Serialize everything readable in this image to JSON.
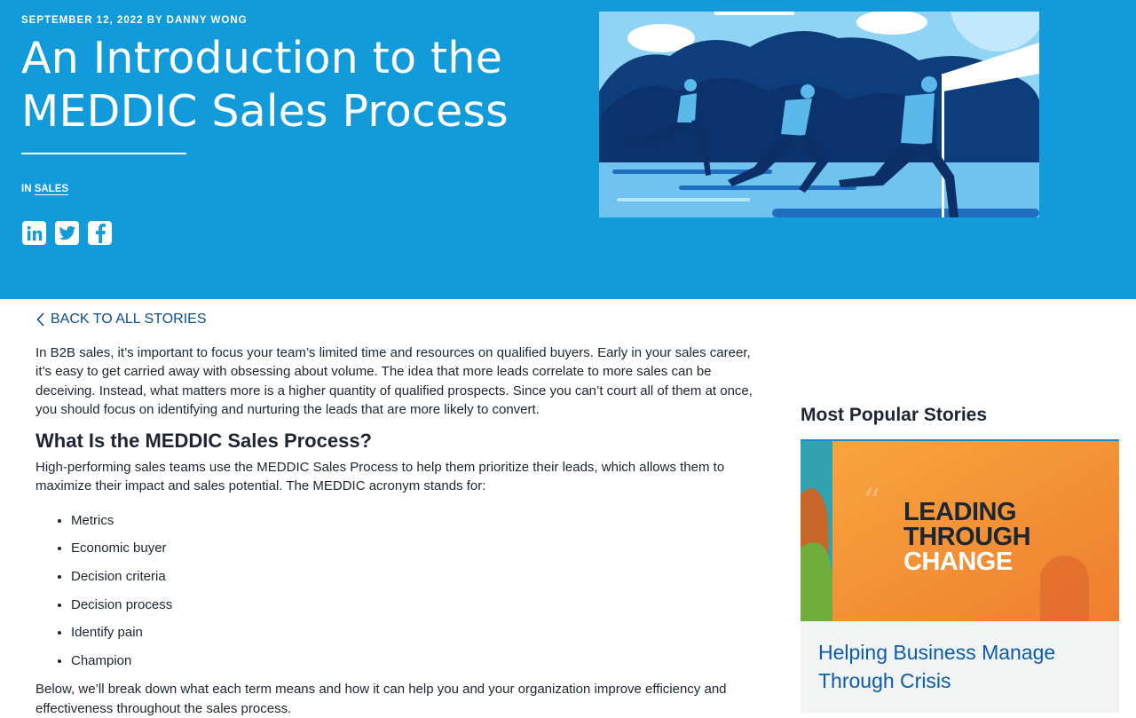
{
  "hero": {
    "meta": "September 12, 2022 by Danny Wong",
    "title_line1": "An Introduction to the",
    "title_line2": "MEDDIC Sales Process",
    "category_prefix": "IN",
    "category": "SALES",
    "share_icons": [
      "linkedin-icon",
      "twitter-icon",
      "facebook-icon"
    ]
  },
  "nav": {
    "back": "BACK TO ALL STORIES"
  },
  "article": {
    "intro": "In B2B sales, it’s important to focus your team’s limited time and resources on qualified buyers. Early in your sales career, it’s easy to get carried away with obsessing about volume. The idea that more leads correlate to more sales can be deceiving. Instead, what matters more is a higher quantity of qualified prospects. Since you can’t court all of them at once, you should focus on identifying and nurturing the leads that are more likely to convert.",
    "heading": "What Is the MEDDIC Sales Process?",
    "para2": "High-performing sales teams use the MEDDIC Sales Process to help them prioritize their leads, which allows them to maximize their impact and sales potential. The MEDDIC acronym stands for:",
    "list": [
      "Metrics",
      "Economic buyer",
      "Decision criteria",
      "Decision process",
      "Identify pain",
      "Champion"
    ],
    "para3": "Below, we’ll break down what each term means and how it can help you and your organization improve efficiency and effectiveness throughout the sales process."
  },
  "sidebar": {
    "title": "Most Popular Stories",
    "card": {
      "image_text": [
        "LEADING",
        "THROUGH",
        "CHANGE"
      ],
      "title": "Helping Business Manage Through Crisis"
    }
  },
  "colors": {
    "hero": "#119bdb",
    "link": "#0b5cab",
    "accent": "#0f8fd1"
  }
}
